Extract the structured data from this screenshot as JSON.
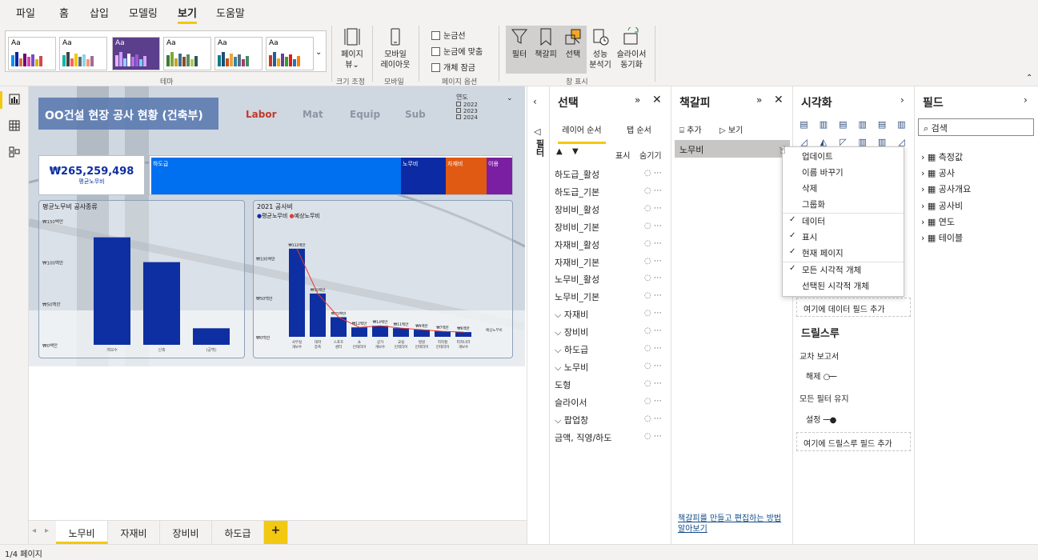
{
  "menu": {
    "file": "파일",
    "home": "홈",
    "insert": "삽입",
    "modeling": "모델링",
    "view": "보기",
    "help": "도움말"
  },
  "ribbon": {
    "theme_label": "테마",
    "page_view": "페이지\n뷰",
    "page_view_l1": "페이지",
    "page_view_l2": "뷰",
    "size_group": "크기 조정",
    "mobile_l1": "모바일",
    "mobile_l2": "레이아웃",
    "mobile_group": "모바일",
    "gridlines": "눈금선",
    "snap": "눈금에 맞춤",
    "lock": "개체 잠금",
    "page_options_group": "페이지 옵션",
    "filter": "필터",
    "bookmark": "책갈피",
    "selection": "선택",
    "perf_l1": "성능",
    "perf_l2": "분석기",
    "slicer_l1": "슬라이서",
    "slicer_l2": "동기화",
    "show_group": "창 표시",
    "theme_aa": "Aa"
  },
  "report": {
    "title": "OO건설 현장 공사 현황 (건축부)",
    "nav_labor": "Labor",
    "nav_mat": "Mat",
    "nav_equip": "Equip",
    "nav_sub": "Sub",
    "year_label": "연도",
    "years": [
      "2022",
      "2023",
      "2024"
    ],
    "kpi_value": "₩265,259,498",
    "kpi_label": "평균노무비",
    "tree_labels": [
      "하도급",
      "노무비",
      "자재비",
      "이용"
    ],
    "chart1_title": "평균노무비 공사종류",
    "chart2_title": "2021 공사비",
    "chart2_legend1": "평균노무비",
    "chart2_legend2": "예상노무비"
  },
  "chart_data": [
    {
      "type": "bar",
      "title": "평균노무비 공사종류",
      "categories": [
        "개보수",
        "신축",
        "(공백)"
      ],
      "values": [
        130000000,
        100000000,
        20000000
      ],
      "ylabels": [
        "₩150백만",
        "₩100백만",
        "₩50백만",
        "₩0백만"
      ]
    },
    {
      "type": "bar",
      "title": "2021 공사비",
      "categories": [
        "사무실 개보수",
        "대학 증축",
        "스포츠 센터",
        "쇼 인테리어",
        "상가 개보수",
        "교실 인테리어",
        "병원 인테리어",
        "지하철 인테리어",
        "피자나라 개보수"
      ],
      "values": [
        112000000,
        55000000,
        25000000,
        12000000,
        14000000,
        11000000,
        9000000,
        7000000,
        6000000
      ],
      "ylabels": [
        "₩100백만",
        "₩50백만",
        "₩0백만"
      ],
      "value_labels": [
        "₩112백만",
        "₩55백만",
        "₩25백만",
        "₩12백만",
        "₩14백만",
        "₩11백만",
        "₩9백만",
        "₩7백만",
        "₩6백만"
      ],
      "series_line_label": "예상노무비"
    }
  ],
  "pages": {
    "tab1": "노무비",
    "tab2": "자재비",
    "tab3": "장비비",
    "tab4": "하도급",
    "add": "+",
    "status": "1/4 페이지"
  },
  "selection_pane": {
    "title": "선택",
    "tab_layer": "레이어 순서",
    "tab_order": "탭 순서",
    "show": "표시",
    "hide": "숨기기",
    "side_label": "필터",
    "items": [
      "하도급_활성",
      "하도급_기본",
      "장비비_활성",
      "장비비_기본",
      "자재비_활성",
      "자재비_기본",
      "노무비_활성",
      "노무비_기본",
      "자재비",
      "장비비",
      "하도급",
      "노무비",
      "도형",
      "슬라이서",
      "팝업창",
      "금액, 직영/하도"
    ]
  },
  "bookmark_pane": {
    "title": "책갈피",
    "add": "추가",
    "view": "보기",
    "item": "노무비",
    "help_link": "책갈피를 만들고 편집하는 방법 알아보기"
  },
  "context_menu": {
    "update": "업데이트",
    "rename": "이름 바꾸기",
    "delete": "삭제",
    "group": "그룹화",
    "data": "데이터",
    "display": "표시",
    "current_page": "현재 페이지",
    "all_visuals": "모든 시각적 개체",
    "selected_visuals": "선택된 시각적 개체",
    "check": "✓"
  },
  "viz_pane": {
    "title": "시각화",
    "add_data": "여기에 데이터 필드 추가",
    "drill_title": "드릴스루",
    "cross_report": "교차 보고서",
    "off": "해제",
    "keep_filters": "모든 필터 유지",
    "on": "설정",
    "add_drill": "여기에 드릴스루 필드 추가"
  },
  "fields_pane": {
    "title": "필드",
    "search": "검색",
    "items": [
      "측정값",
      "공사",
      "공사개요",
      "공사비",
      "연도",
      "테이블"
    ]
  },
  "colors": {
    "accent": "#f2c811",
    "bar": "#0e2fa1",
    "tree_blue": "#0070f0",
    "tree_navy": "#0b2aa4",
    "tree_orange": "#e05a13",
    "tree_purple": "#7b1fa2"
  }
}
